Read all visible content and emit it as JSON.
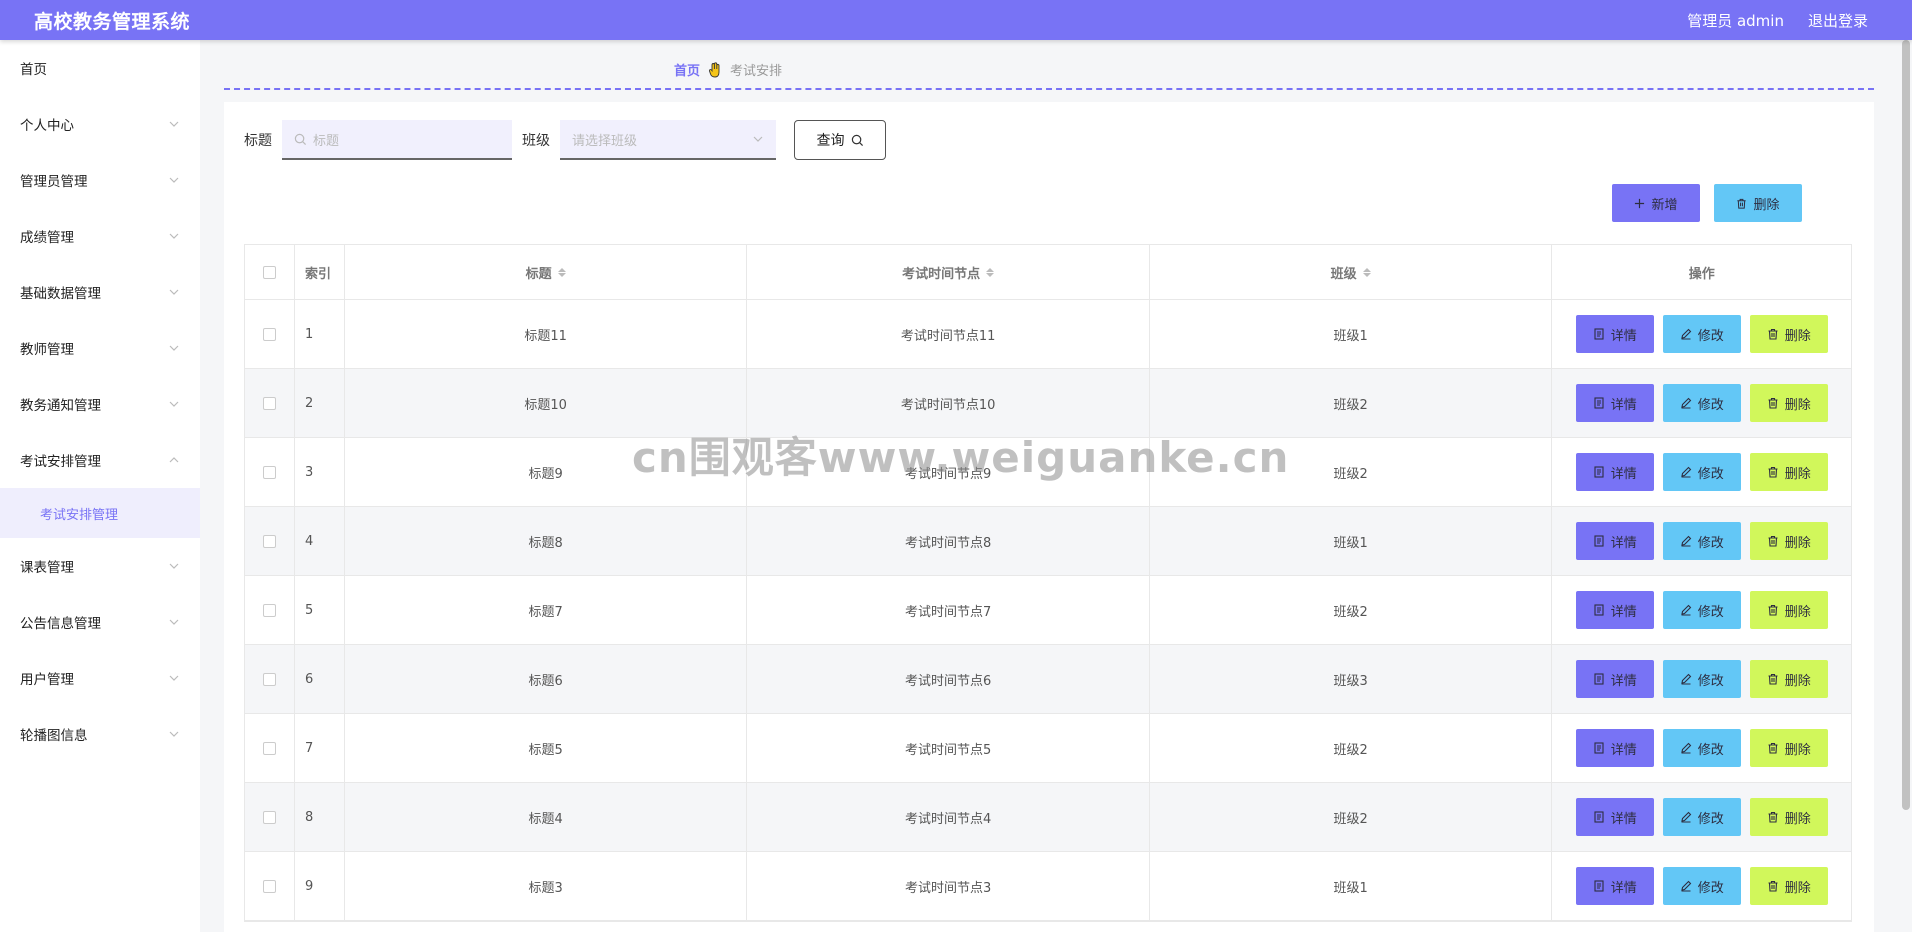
{
  "header": {
    "app_title": "高校教务管理系统",
    "user_label": "管理员 admin",
    "logout_label": "退出登录"
  },
  "sidebar": {
    "items": [
      {
        "label": "首页"
      },
      {
        "label": "个人中心"
      },
      {
        "label": "管理员管理"
      },
      {
        "label": "成绩管理"
      },
      {
        "label": "基础数据管理"
      },
      {
        "label": "教师管理"
      },
      {
        "label": "教务通知管理"
      },
      {
        "label": "考试安排管理"
      },
      {
        "label": "课表管理"
      },
      {
        "label": "公告信息管理"
      },
      {
        "label": "用户管理"
      },
      {
        "label": "轮播图信息"
      }
    ],
    "submenu_active": "考试安排管理"
  },
  "breadcrumb": {
    "home": "首页",
    "current": "考试安排"
  },
  "search": {
    "title_label": "标题",
    "title_placeholder": "标题",
    "class_label": "班级",
    "class_placeholder": "请选择班级",
    "query_label": "查询"
  },
  "actions": {
    "add_label": "新增",
    "delete_label": "删除"
  },
  "table": {
    "headers": {
      "index": "索引",
      "title": "标题",
      "time": "考试时间节点",
      "class": "班级",
      "ops": "操作"
    },
    "row_buttons": {
      "detail": "详情",
      "edit": "修改",
      "delete": "删除"
    },
    "rows": [
      {
        "index": "1",
        "title": "标题11",
        "time": "考试时间节点11",
        "class": "班级1"
      },
      {
        "index": "2",
        "title": "标题10",
        "time": "考试时间节点10",
        "class": "班级2"
      },
      {
        "index": "3",
        "title": "标题9",
        "time": "考试时间节点9",
        "class": "班级2"
      },
      {
        "index": "4",
        "title": "标题8",
        "time": "考试时间节点8",
        "class": "班级1"
      },
      {
        "index": "5",
        "title": "标题7",
        "time": "考试时间节点7",
        "class": "班级2"
      },
      {
        "index": "6",
        "title": "标题6",
        "time": "考试时间节点6",
        "class": "班级3"
      },
      {
        "index": "7",
        "title": "标题5",
        "time": "考试时间节点5",
        "class": "班级2"
      },
      {
        "index": "8",
        "title": "标题4",
        "time": "考试时间节点4",
        "class": "班级2"
      },
      {
        "index": "9",
        "title": "标题3",
        "time": "考试时间节点3",
        "class": "班级1"
      }
    ]
  },
  "watermark": "cn围观客www.weiguanke.cn",
  "colors": {
    "primary": "#7873f5",
    "info": "#63c7f6",
    "warning": "#d1f75b"
  }
}
